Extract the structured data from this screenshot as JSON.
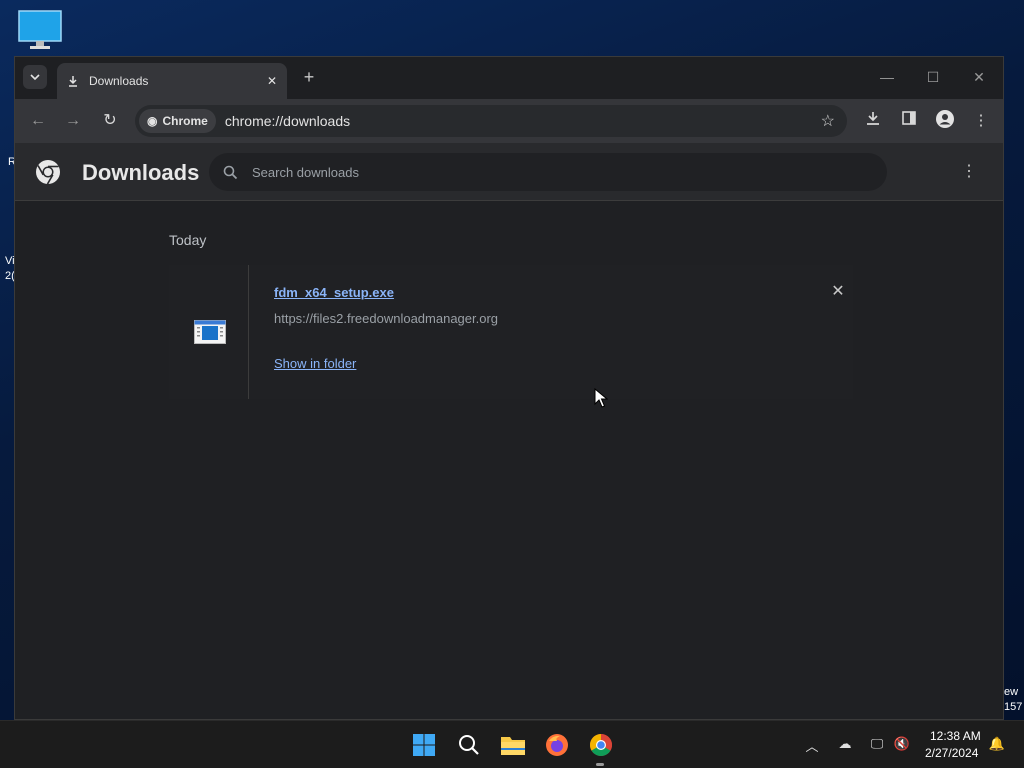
{
  "desktop": {
    "left_text_1": "R",
    "left_text_2": "Vi",
    "left_text_3": "2(",
    "right_text_1": "ew",
    "right_text_2": "157"
  },
  "tabstrip": {
    "tab_title": "Downloads",
    "close_glyph": "✕",
    "new_tab_glyph": "+"
  },
  "toolbar": {
    "chip_label": "Chrome",
    "url": "chrome://downloads"
  },
  "page": {
    "title": "Downloads",
    "search_placeholder": "Search downloads"
  },
  "downloads": {
    "date_group": "Today",
    "items": [
      {
        "file_name": "fdm_x64_setup.exe",
        "source_url": "https://files2.freedownloadmanager.org",
        "action_label": "Show in folder"
      }
    ]
  },
  "taskbar": {
    "time": "12:38 AM",
    "date": "2/27/2024"
  },
  "colors": {
    "link": "#8ab4f8",
    "page_bg": "#202124",
    "header_bg": "#292a2d",
    "toolbar_bg": "#35363a"
  }
}
